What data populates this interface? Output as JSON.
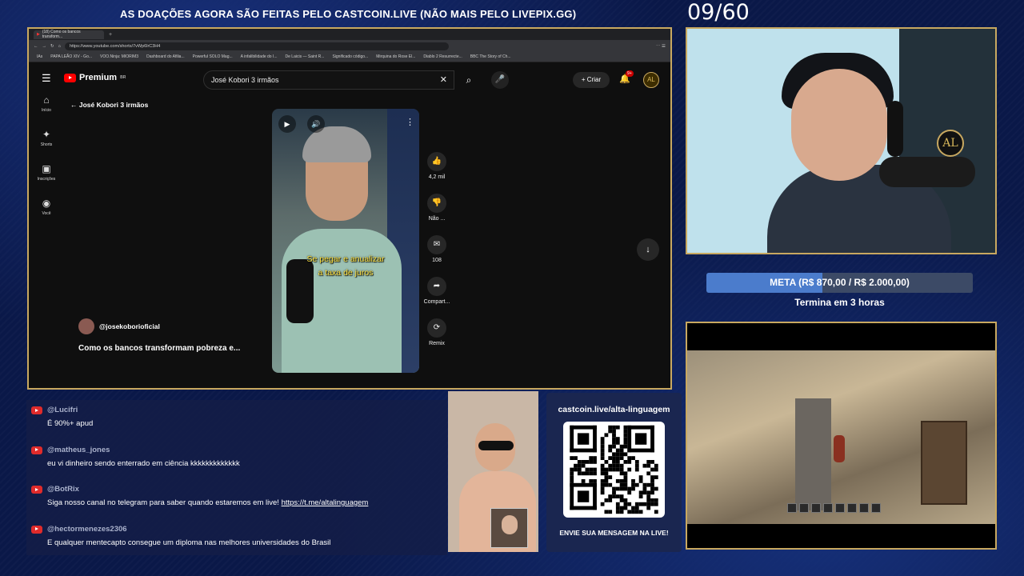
{
  "banner": "AS DOAÇÕES AGORA SÃO FEITAS PELO CASTCOIN.LIVE (NÃO MAIS PELO LIVEPIX.GG)",
  "counter": "09/60",
  "browser": {
    "tab_title": "(18) Como os bancos transform...",
    "url": "https://www.youtube.com/shorts/7vWp6lrC3H4",
    "bookmarks": [
      "IAs",
      "PAPA LEÃO XIV - Go...",
      "VOO.Ninja: MIORIM3",
      "Dashboard do Afilia...",
      "Powerful SOLO Mag...",
      "A infalibilidade do I...",
      "De Laicis — Saint R...",
      "Significado código...",
      "Mirquina do Rose El...",
      "Diablo 2 Resurrecte...",
      "BBC The Story of Ch..."
    ]
  },
  "youtube": {
    "logo": "Premium",
    "logo_sup": "BR",
    "search_value": "José Kobori 3 irmãos",
    "create_label": "Criar",
    "notif_badge": "9+",
    "avatar_text": "AL",
    "nav": [
      {
        "icon": "⌂",
        "label": "Início"
      },
      {
        "icon": "✦",
        "label": "Shorts"
      },
      {
        "icon": "▣",
        "label": "Inscrições"
      },
      {
        "icon": "◉",
        "label": "Você"
      }
    ],
    "back_label": "José Kobori 3 irmãos",
    "caption_line1": "Se pegar e anualizar",
    "caption_line2": "a taxa de juros",
    "actions": [
      {
        "icon": "👍",
        "label": "4,2 mil"
      },
      {
        "icon": "👎",
        "label": "Não ..."
      },
      {
        "icon": "✉",
        "label": "108"
      },
      {
        "icon": "➦",
        "label": "Compart..."
      },
      {
        "icon": "⟳",
        "label": "Remix"
      }
    ],
    "channel": "@josekoborioficial",
    "video_title": "Como os bancos transformam pobreza e..."
  },
  "goal": {
    "text": "META (R$ 870,00 / R$ 2.000,00)",
    "progress": 0.435,
    "ends": "Termina em 3 horas"
  },
  "chat": [
    {
      "user": "@Lucifri",
      "text": "É 90%+ apud"
    },
    {
      "user": "@matheus_jones",
      "text": "eu vi dinheiro sendo enterrado em ciência kkkkkkkkkkkkk"
    },
    {
      "user": "@BotRix",
      "text": "Siga nosso canal no telegram para saber quando estaremos em live! ",
      "link": "https://t.me/altalinguagem"
    },
    {
      "user": "@hectormenezes2306",
      "text": "E qualquer mentecapto consegue um diploma nas melhores universidades do Brasil"
    }
  ],
  "qr": {
    "title": "castcoin.live/alta-linguagem",
    "footer": "ENVIE SUA MENSAGEM NA LIVE!"
  },
  "colors": {
    "frame": "#c8a860",
    "youtube_red": "#ff0000",
    "caption": "#ffe340"
  }
}
